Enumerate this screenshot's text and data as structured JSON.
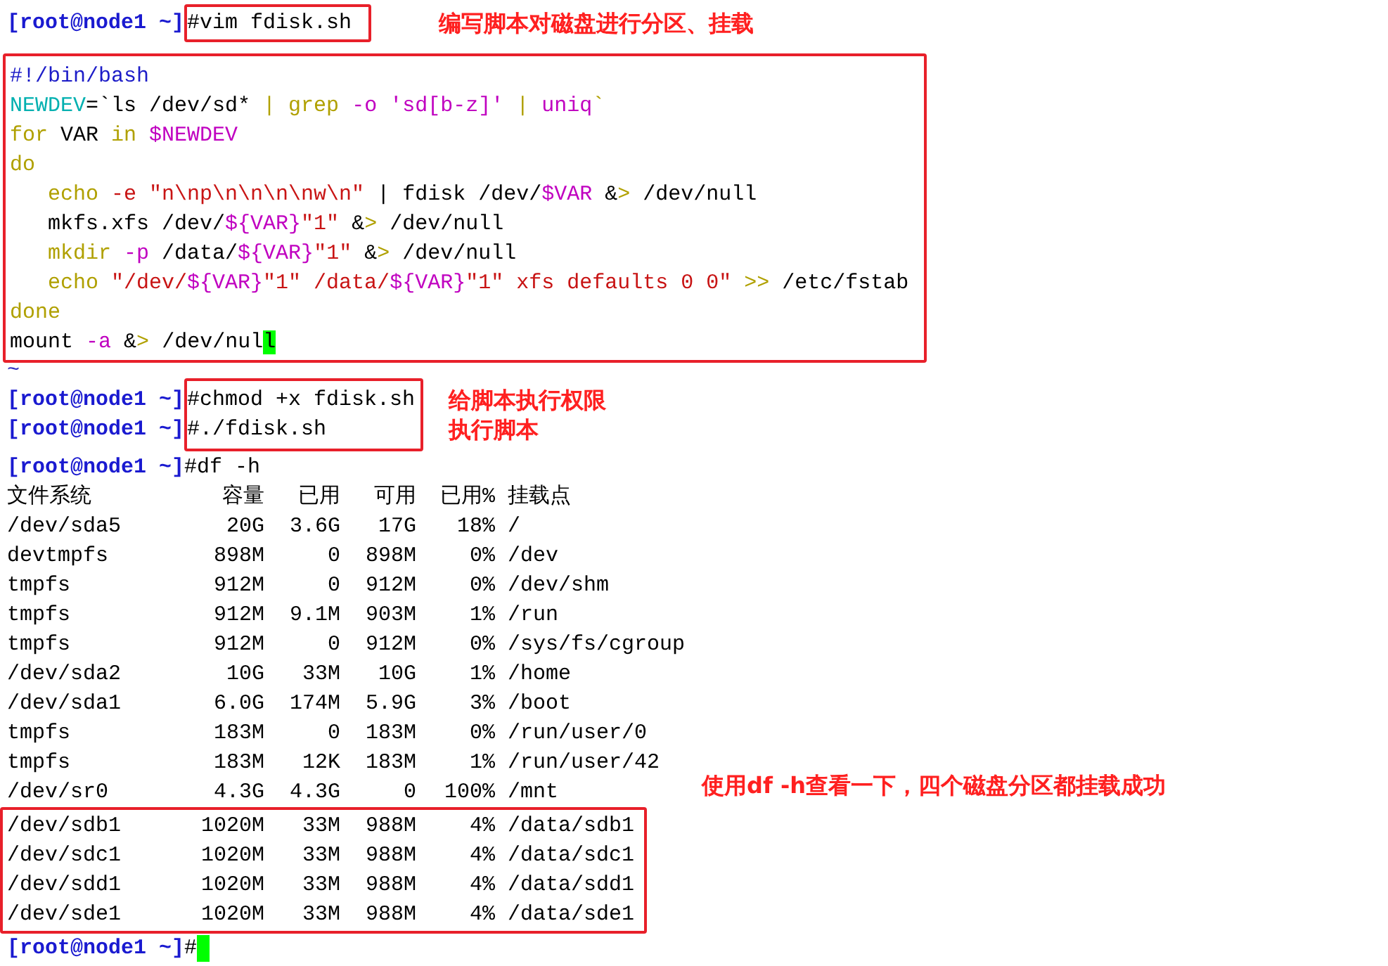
{
  "vim_session": {
    "prompt": "[root@node1 ~]",
    "command": "#vim fdisk.sh",
    "note": "编写脚本对磁盘进行分区、挂载",
    "script_lines": [
      [
        {
          "kind": "comment",
          "text": "#!/bin/bash"
        }
      ],
      [
        {
          "kind": "assign",
          "text": "NEWDEV"
        },
        {
          "kind": "plain",
          "text": "=`ls /dev/sd* "
        },
        {
          "kind": "keyword",
          "text": "| grep"
        },
        {
          "kind": "option",
          "text": " -o"
        },
        {
          "kind": "option",
          "text": " 'sd[b-z]'"
        },
        {
          "kind": "keyword",
          "text": " |"
        },
        {
          "kind": "option",
          "text": " uniq"
        },
        {
          "kind": "keyword",
          "text": "`"
        }
      ],
      [
        {
          "kind": "keyword",
          "text": "for"
        },
        {
          "kind": "plain",
          "text": " VAR "
        },
        {
          "kind": "keyword",
          "text": "in"
        },
        {
          "kind": "variable",
          "text": " $NEWDEV"
        }
      ],
      [
        {
          "kind": "keyword",
          "text": "do"
        }
      ],
      [
        {
          "kind": "keyword",
          "text": "   echo"
        },
        {
          "kind": "string",
          "text": " -e"
        },
        {
          "kind": "string",
          "text": " \"n\\np\\n\\n\\n\\nw\\n\""
        },
        {
          "kind": "plain",
          "text": " | fdisk /dev/"
        },
        {
          "kind": "variable",
          "text": "$VAR"
        },
        {
          "kind": "plain",
          "text": " &"
        },
        {
          "kind": "keyword",
          "text": ">"
        },
        {
          "kind": "plain",
          "text": " /dev/null"
        }
      ],
      [
        {
          "kind": "plain",
          "text": "   mkfs.xfs /dev/"
        },
        {
          "kind": "variable",
          "text": "${VAR}"
        },
        {
          "kind": "string",
          "text": "\"1\""
        },
        {
          "kind": "plain",
          "text": " &"
        },
        {
          "kind": "keyword",
          "text": ">"
        },
        {
          "kind": "plain",
          "text": " /dev/null"
        }
      ],
      [
        {
          "kind": "keyword",
          "text": "   mkdir"
        },
        {
          "kind": "option",
          "text": " -p"
        },
        {
          "kind": "plain",
          "text": " /data/"
        },
        {
          "kind": "variable",
          "text": "${VAR}"
        },
        {
          "kind": "string",
          "text": "\"1\""
        },
        {
          "kind": "plain",
          "text": " &"
        },
        {
          "kind": "keyword",
          "text": ">"
        },
        {
          "kind": "plain",
          "text": " /dev/null"
        }
      ],
      [
        {
          "kind": "keyword",
          "text": "   echo"
        },
        {
          "kind": "string",
          "text": " \"/dev/"
        },
        {
          "kind": "variable",
          "text": "${VAR}"
        },
        {
          "kind": "string",
          "text": "\"1\" /data/"
        },
        {
          "kind": "variable",
          "text": "${VAR}"
        },
        {
          "kind": "string",
          "text": "\"1\" xfs defaults 0 0\""
        },
        {
          "kind": "keyword",
          "text": " >>"
        },
        {
          "kind": "plain",
          "text": " /etc/fstab"
        }
      ],
      [
        {
          "kind": "keyword",
          "text": "done"
        }
      ],
      [
        {
          "kind": "plain",
          "text": "mount "
        },
        {
          "kind": "option",
          "text": "-a"
        },
        {
          "kind": "plain",
          "text": " &"
        },
        {
          "kind": "keyword",
          "text": ">"
        },
        {
          "kind": "plain",
          "text": " /dev/nul"
        },
        {
          "kind": "cursor",
          "text": "l"
        }
      ]
    ],
    "tilde": "~"
  },
  "exec_session": {
    "lines": [
      {
        "prompt": "[root@node1 ~]",
        "command": "#chmod +x fdisk.sh"
      },
      {
        "prompt": "[root@node1 ~]",
        "command": "#./fdisk.sh"
      }
    ],
    "notes": [
      "给脚本执行权限",
      "执行脚本"
    ]
  },
  "df_session": {
    "prompt": "[root@node1 ~]",
    "command": "#df -h",
    "headers": [
      "文件系统",
      "容量",
      "已用",
      "可用",
      "已用%",
      "挂载点"
    ],
    "rows": [
      {
        "cells": [
          "/dev/sda5",
          "20G",
          "3.6G",
          "17G",
          "18%",
          "/"
        ],
        "boxed": false
      },
      {
        "cells": [
          "devtmpfs",
          "898M",
          "0",
          "898M",
          "0%",
          "/dev"
        ],
        "boxed": false
      },
      {
        "cells": [
          "tmpfs",
          "912M",
          "0",
          "912M",
          "0%",
          "/dev/shm"
        ],
        "boxed": false
      },
      {
        "cells": [
          "tmpfs",
          "912M",
          "9.1M",
          "903M",
          "1%",
          "/run"
        ],
        "boxed": false
      },
      {
        "cells": [
          "tmpfs",
          "912M",
          "0",
          "912M",
          "0%",
          "/sys/fs/cgroup"
        ],
        "boxed": false
      },
      {
        "cells": [
          "/dev/sda2",
          "10G",
          "33M",
          "10G",
          "1%",
          "/home"
        ],
        "boxed": false
      },
      {
        "cells": [
          "/dev/sda1",
          "6.0G",
          "174M",
          "5.9G",
          "3%",
          "/boot"
        ],
        "boxed": false
      },
      {
        "cells": [
          "tmpfs",
          "183M",
          "0",
          "183M",
          "0%",
          "/run/user/0"
        ],
        "boxed": false
      },
      {
        "cells": [
          "tmpfs",
          "183M",
          "12K",
          "183M",
          "1%",
          "/run/user/42"
        ],
        "boxed": false
      },
      {
        "cells": [
          "/dev/sr0",
          "4.3G",
          "4.3G",
          "0",
          "100%",
          "/mnt"
        ],
        "boxed": false
      },
      {
        "cells": [
          "/dev/sdb1",
          "1020M",
          "33M",
          "988M",
          "4%",
          "/data/sdb1"
        ],
        "boxed": true
      },
      {
        "cells": [
          "/dev/sdc1",
          "1020M",
          "33M",
          "988M",
          "4%",
          "/data/sdc1"
        ],
        "boxed": true
      },
      {
        "cells": [
          "/dev/sdd1",
          "1020M",
          "33M",
          "988M",
          "4%",
          "/data/sdd1"
        ],
        "boxed": true
      },
      {
        "cells": [
          "/dev/sde1",
          "1020M",
          "33M",
          "988M",
          "4%",
          "/data/sde1"
        ],
        "boxed": true
      }
    ],
    "note": "使用df -h查看一下，四个磁盘分区都挂载成功",
    "final_prompt": "[root@node1 ~]",
    "final_command": "#"
  }
}
